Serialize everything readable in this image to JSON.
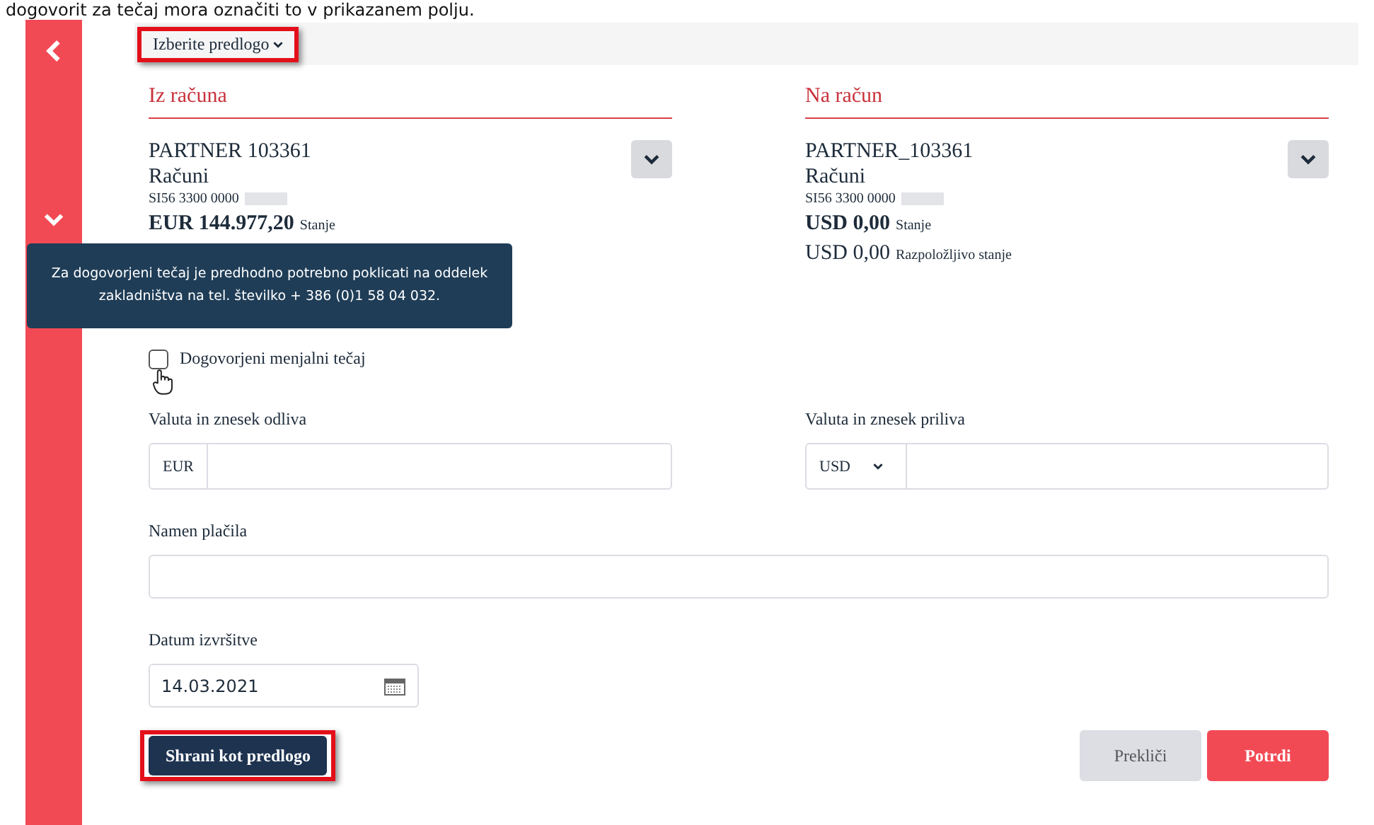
{
  "caption": "dogovorit za tečaj mora označiti to v prikazanem polju.",
  "template_picker": {
    "label": "Izberite predlogo",
    "highlighted": true
  },
  "from_account": {
    "heading": "Iz računa",
    "name": "PARTNER 103361",
    "type": "Računi",
    "iban": "SI56 3300 0000",
    "balance": "EUR 144.977,20",
    "balance_label": "Stanje"
  },
  "to_account": {
    "heading": "Na račun",
    "name": "PARTNER_103361",
    "type": "Računi",
    "iban": "SI56 3300 0000",
    "balance": "USD 0,00",
    "balance_label": "Stanje",
    "available": "USD 0,00",
    "available_label": "Razpoložljivo stanje"
  },
  "tooltip": "Za dogovorjeni tečaj je predhodno potrebno poklicati na oddelek zakladništva na tel. številko + 386 (0)1 58 04 032.",
  "agreed_rate": {
    "label": "Dogovorjeni menjalni tečaj",
    "checked": false
  },
  "outflow": {
    "label": "Valuta in znesek odliva",
    "currency": "EUR"
  },
  "inflow": {
    "label": "Valuta in znesek priliva",
    "currency": "USD"
  },
  "purpose": {
    "label": "Namen plačila"
  },
  "date": {
    "label": "Datum izvršitve",
    "value": "14.03.2021"
  },
  "buttons": [
    {
      "label": "Shrani kot predlogo",
      "kind": "dark",
      "highlighted": true
    },
    {
      "label": "Prekliči",
      "kind": "secondary",
      "highlighted": false
    },
    {
      "label": "Potrdi",
      "kind": "primary",
      "highlighted": false
    }
  ]
}
